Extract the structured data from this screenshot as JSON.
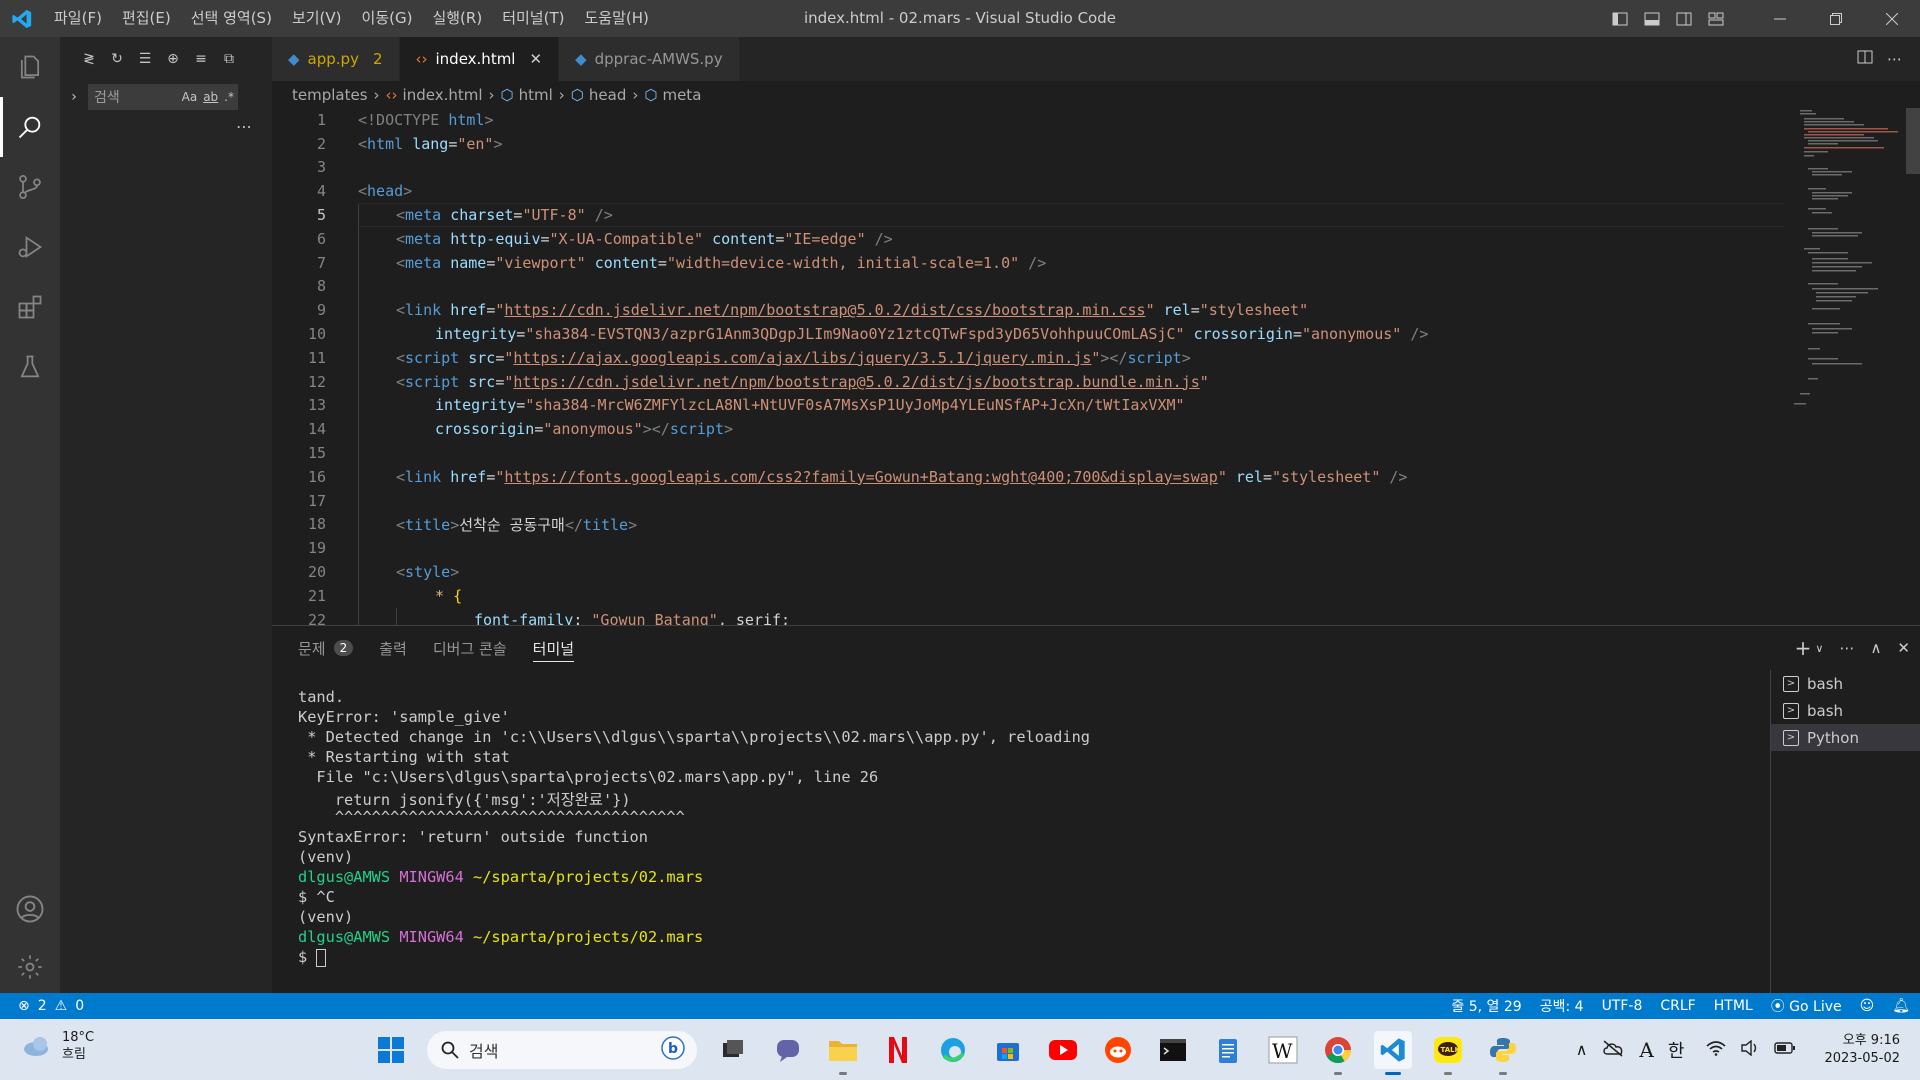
{
  "titlebar": {
    "menus": [
      "파일(F)",
      "편집(E)",
      "선택 영역(S)",
      "보기(V)",
      "이동(G)",
      "실행(R)",
      "터미널(T)",
      "도움말(H)"
    ],
    "title": "index.html - 02.mars - Visual Studio Code"
  },
  "sidebar": {
    "search_placeholder": "검색",
    "opt_case": "Aa",
    "opt_word": "ab",
    "opt_regex": ".*"
  },
  "tabs": [
    {
      "label": "app.py",
      "problems": "2"
    },
    {
      "label": "index.html"
    },
    {
      "label": "dpprac-AMWS.py"
    }
  ],
  "breadcrumbs": [
    "templates",
    "index.html",
    "html",
    "head",
    "meta"
  ],
  "editor": {
    "line_numbers": [
      "1",
      "2",
      "3",
      "4",
      "5",
      "6",
      "7",
      "8",
      "9",
      "10",
      "11",
      "12",
      "13",
      "14",
      "15",
      "16",
      "17",
      "18",
      "19",
      "20",
      "21",
      "22"
    ],
    "current_line": 5,
    "text": {
      "doctype": "<!DOCTYPE",
      "html": "html",
      "lang_attr": "lang",
      "lang_val": "\"en\"",
      "head": "head",
      "meta": "meta",
      "charset_attr": "charset",
      "charset_val": "\"UTF-8\"",
      "httpequiv_attr": "http-equiv",
      "httpequiv_val": "\"X-UA-Compatible\"",
      "content_attr": "content",
      "ie_val": "\"IE=edge\"",
      "name_attr": "name",
      "viewport_val": "\"viewport\"",
      "viewport_content_val": "\"width=device-width, initial-scale=1.0\"",
      "link": "link",
      "href_attr": "href",
      "bootstrap_css": "https://cdn.jsdelivr.net/npm/bootstrap@5.0.2/dist/css/bootstrap.min.css",
      "rel_attr": "rel",
      "stylesheet_val": "\"stylesheet\"",
      "integrity_attr": "integrity",
      "integrity_css_val": "\"sha384-EVSTQN3/azprG1Anm3QDgpJLIm9Nao0Yz1ztcQTwFspd3yD65VohhpuuCOmLASjC\"",
      "crossorigin_attr": "crossorigin",
      "anonymous_val": "\"anonymous\"",
      "script": "script",
      "src_attr": "src",
      "jquery_src": "https://ajax.googleapis.com/ajax/libs/jquery/3.5.1/jquery.min.js",
      "bootstrap_js": "https://cdn.jsdelivr.net/npm/bootstrap@5.0.2/dist/js/bootstrap.bundle.min.js",
      "integrity_js_val": "\"sha384-MrcW6ZMFYlzcLA8Nl+NtUVF0sA7MsXsP1UyJoMp4YLEuNSfAP+JcXn/tWtIaxVXM\"",
      "fonts_href": "https://fonts.googleapis.com/css2?family=Gowun+Batang:wght@400;700&display=swap",
      "title_tag": "title",
      "title_text": "선착순 공동구매",
      "style": "style",
      "star": "*",
      "brace": "{",
      "font_prop": "font-family",
      "font_val": "\"Gowun Batang\"",
      "font_tail": ", serif;"
    }
  },
  "panel": {
    "tabs": [
      {
        "label": "문제",
        "badge": "2"
      },
      {
        "label": "출력"
      },
      {
        "label": "디버그 콘솔"
      },
      {
        "label": "터미널"
      }
    ],
    "terminal": {
      "l1": "tand.",
      "l2": "KeyError: 'sample_give'",
      "l3": " * Detected change in 'c:\\\\Users\\\\dlgus\\\\sparta\\\\projects\\\\02.mars\\\\app.py', reloading",
      "l4": " * Restarting with stat",
      "l5": "  File \"c:\\Users\\dlgus\\sparta\\projects\\02.mars\\app.py\", line 26",
      "l6": "    return jsonify({'msg':'저장완료'})",
      "l7": "    ^^^^^^^^^^^^^^^^^^^^^^^^^^^^^^^^^^^^^^",
      "l8": "SyntaxError: 'return' outside function",
      "l9": "(venv)",
      "user": "dlgus@AMWS",
      "mingw": "MINGW64",
      "path": "~/sparta/projects/02.mars",
      "l11": "$ ^C",
      "l12": "(venv)",
      "prompt": "$ "
    },
    "terminal_list": [
      "bash",
      "bash",
      "Python"
    ]
  },
  "statusbar": {
    "errors": "2",
    "warnings": "0",
    "position": "줄 5, 열 29",
    "spaces": "공백: 4",
    "encoding": "UTF-8",
    "eol": "CRLF",
    "language": "HTML",
    "golive": "Go Live"
  },
  "taskbar": {
    "temp": "18°C",
    "condition": "흐림",
    "search": "검색",
    "ime_a": "A",
    "ime_han": "한",
    "time": "오후 9:16",
    "date": "2023-05-02"
  },
  "colors": {
    "accent": "#007acc",
    "activitybar": "#333333",
    "sidebar": "#252526",
    "editor_bg": "#1e1e1e"
  }
}
